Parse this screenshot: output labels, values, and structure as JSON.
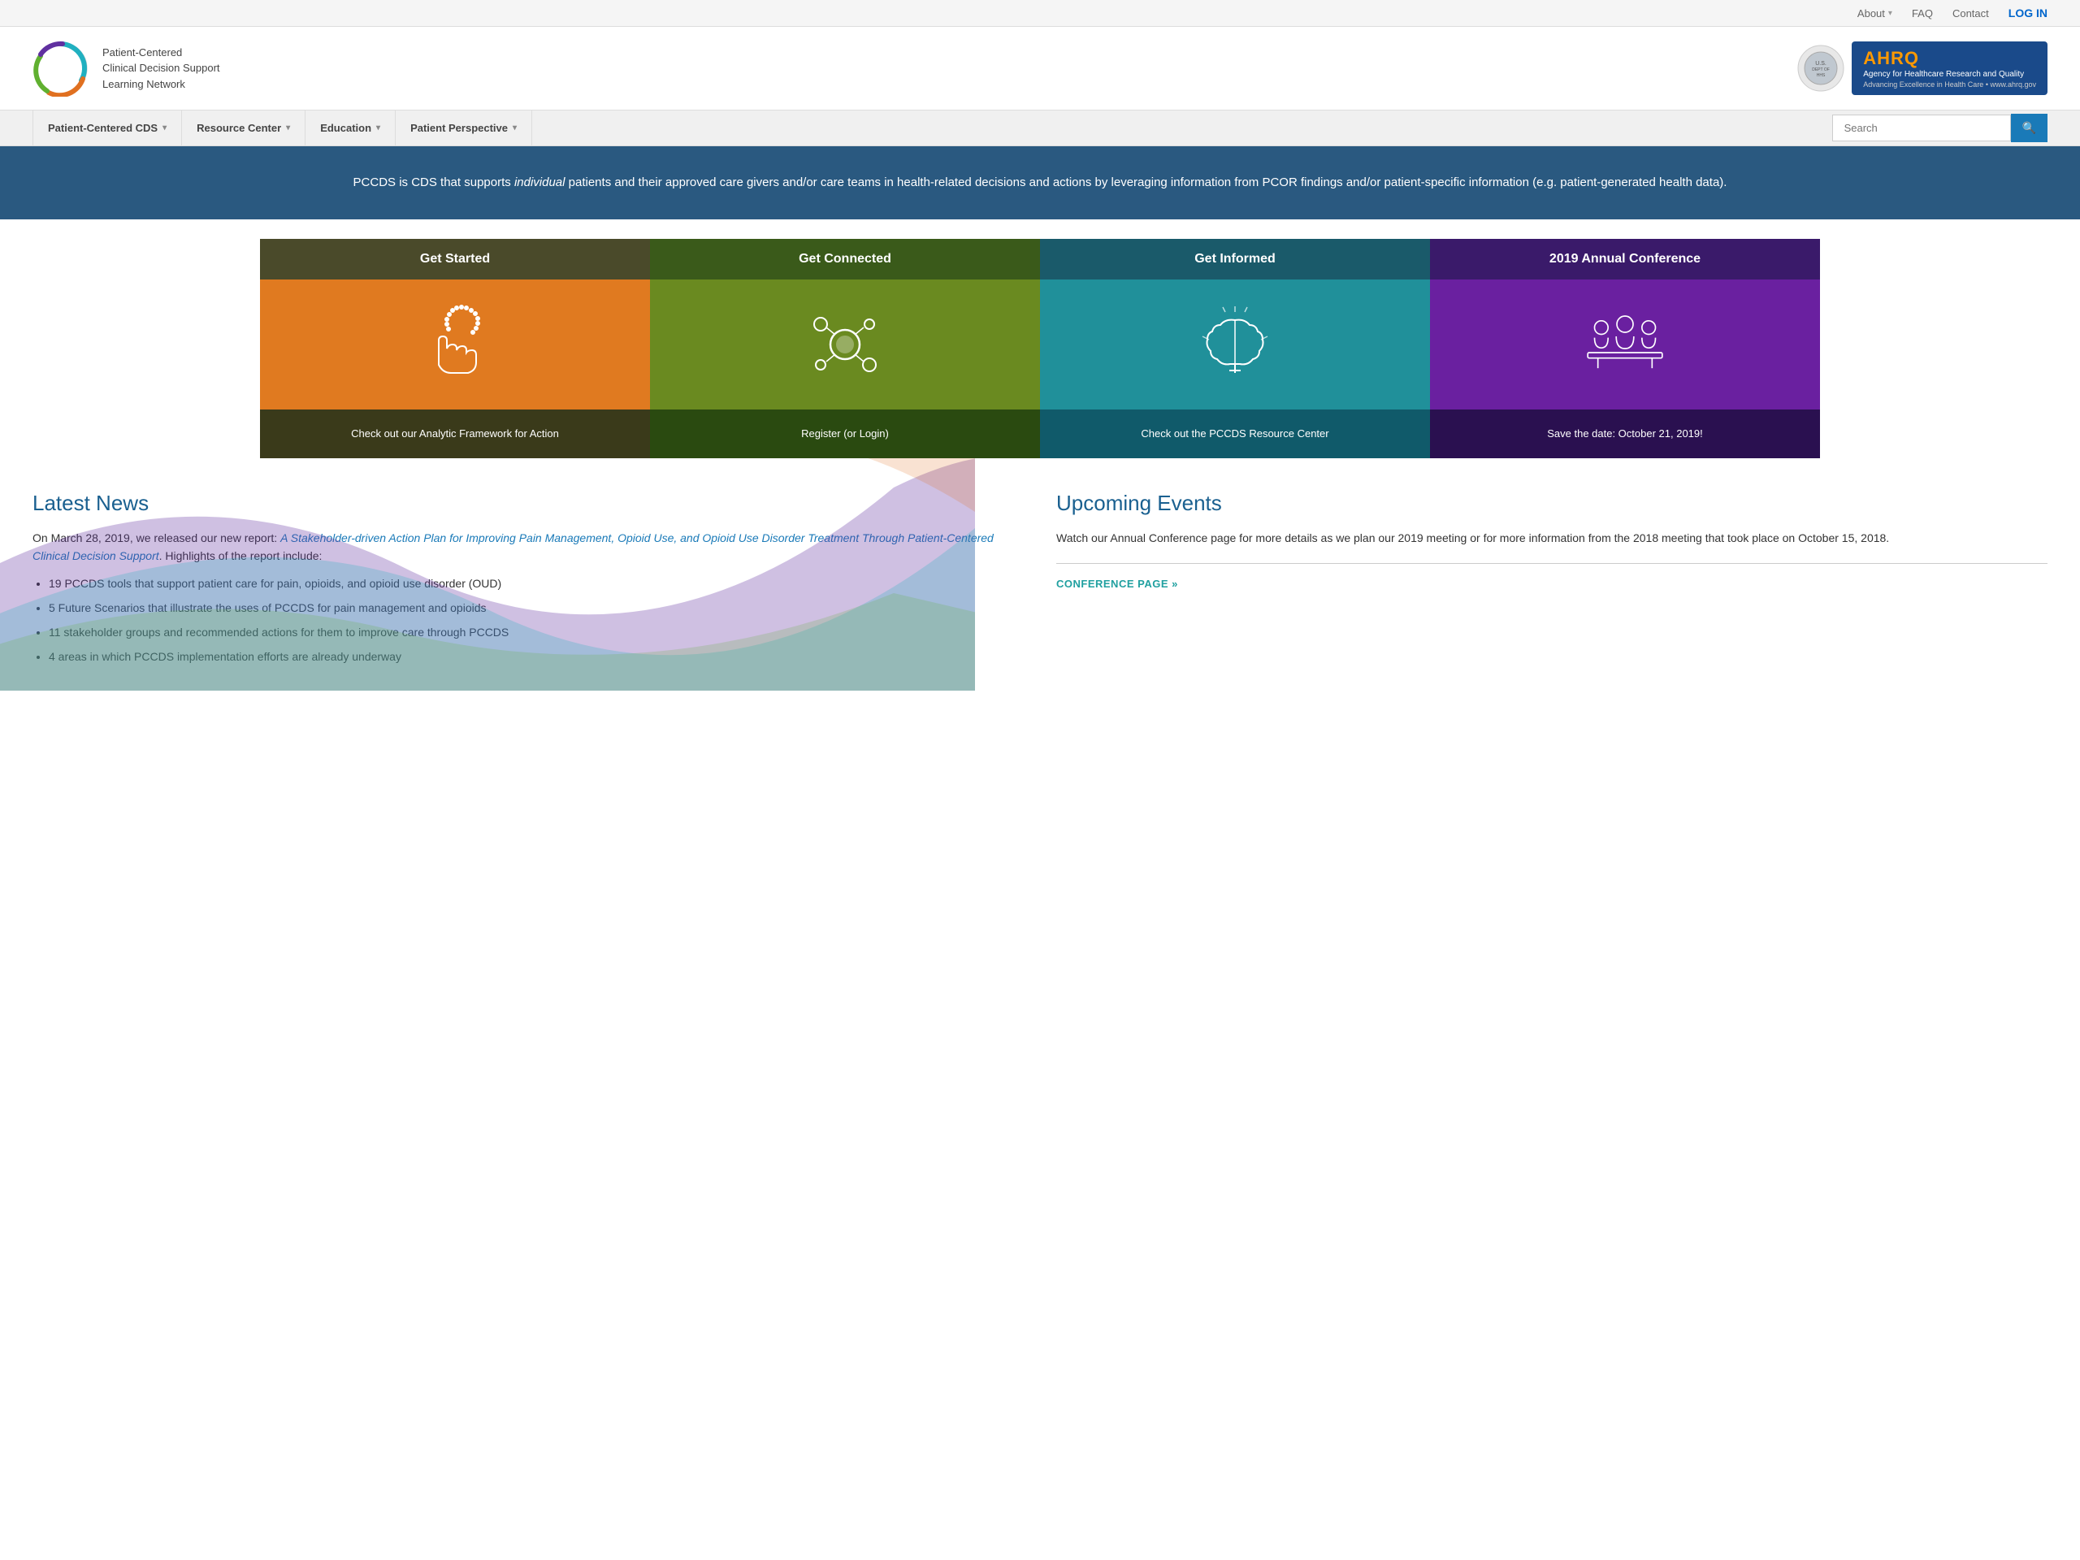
{
  "topbar": {
    "about_label": "About",
    "faq_label": "FAQ",
    "contact_label": "Contact",
    "login_label": "LOG IN"
  },
  "header": {
    "logo_line1": "Patient-Centered",
    "logo_line2": "Clinical Decision Support",
    "logo_line3": "Learning Network",
    "ahrq_abbr": "AHRQ",
    "ahrq_full": "Agency for Healthcare Research and Quality",
    "ahrq_sub": "Advancing Excellence in Health Care • www.ahrq.gov"
  },
  "nav": {
    "item1": "Patient-Centered CDS",
    "item2": "Resource Center",
    "item3": "Education",
    "item4": "Patient Perspective",
    "search_placeholder": "Search"
  },
  "hero": {
    "text_before": "PCCDS is CDS that supports ",
    "text_italic": "individual",
    "text_after": " patients and their approved care givers and/or care teams in health-related decisions and actions by leveraging information from PCOR findings and/or patient-specific information (e.g. patient-generated health data)."
  },
  "cards": [
    {
      "title": "Get Started",
      "footer": "Check out our Analytic Framework for Action",
      "icon": "hand"
    },
    {
      "title": "Get Connected",
      "footer": "Register (or Login)",
      "icon": "network"
    },
    {
      "title": "Get Informed",
      "footer": "Check out the PCCDS Resource Center",
      "icon": "brain"
    },
    {
      "title": "2019 Annual Conference",
      "footer": "Save the date: October 21, 2019!",
      "icon": "meeting"
    }
  ],
  "news": {
    "title": "Latest News",
    "intro": "On March 28, 2019, we released our new report: ",
    "link_text": "A Stakeholder-driven Action Plan for Improving Pain Management, Opioid Use, and Opioid Use Disorder Treatment Through Patient-Centered Clinical Decision Support",
    "link_suffix": ". Highlights of the report include:",
    "items": [
      "19 PCCDS tools that support patient care for pain, opioids, and opioid use disorder (OUD)",
      "5 Future Scenarios that illustrate the uses of PCCDS for pain management and opioids",
      "11 stakeholder groups and recommended actions for them to improve care through PCCDS",
      "4 areas in which PCCDS implementation efforts are already underway"
    ]
  },
  "events": {
    "title": "Upcoming Events",
    "description": "Watch our Annual Conference page for more details as we plan our 2019 meeting or for more information from the 2018 meeting that took place on October 15, 2018.",
    "conference_link": "CONFERENCE PAGE »"
  }
}
